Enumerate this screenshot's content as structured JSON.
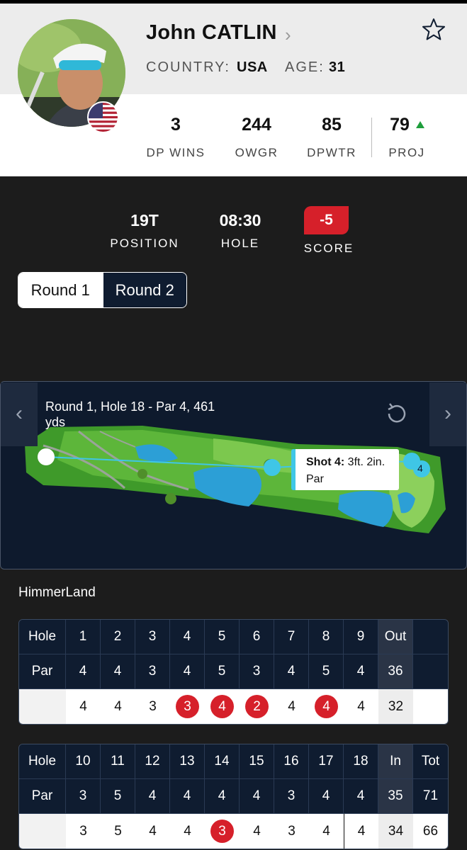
{
  "player": {
    "name": "John CATLIN",
    "country_label": "COUNTRY:",
    "country": "USA",
    "age_label": "AGE:",
    "age": "31",
    "flag_icon": "us-flag-icon",
    "favorite_icon": "star-outline-icon"
  },
  "stats": [
    {
      "value": "3",
      "label": "DP WINS"
    },
    {
      "value": "244",
      "label": "OWGR"
    },
    {
      "value": "85",
      "label": "DPWTR"
    },
    {
      "value": "79",
      "label": "PROJ",
      "trend": "up"
    }
  ],
  "summary": {
    "position": {
      "value": "19T",
      "label": "POSITION"
    },
    "hole": {
      "value": "08:30",
      "label": "HOLE"
    },
    "score": {
      "value": "-5",
      "label": "SCORE"
    }
  },
  "rounds": {
    "tabs": [
      "Round 1",
      "Round 2"
    ],
    "selected": "Round 1"
  },
  "hole_map": {
    "title": "Round 1, Hole 18 - Par 4, 461 yds",
    "shot_label": "Shot 4:",
    "shot_distance": "3ft. 2in.",
    "shot_result": "Par",
    "ball_number": "4"
  },
  "course": {
    "name": "HimmerLand"
  },
  "scorecard": {
    "front": {
      "hole_label": "Hole",
      "par_label": "Par",
      "holes": [
        "1",
        "2",
        "3",
        "4",
        "5",
        "6",
        "7",
        "8",
        "9"
      ],
      "total_label": "Out",
      "pars": [
        "4",
        "4",
        "3",
        "4",
        "5",
        "3",
        "4",
        "5",
        "4"
      ],
      "par_total": "36",
      "scores": [
        "4",
        "4",
        "3",
        "3",
        "4",
        "2",
        "4",
        "4",
        "4"
      ],
      "score_total": "32"
    },
    "back": {
      "hole_label": "Hole",
      "par_label": "Par",
      "holes": [
        "10",
        "11",
        "12",
        "13",
        "14",
        "15",
        "16",
        "17",
        "18"
      ],
      "total_label": "In",
      "grand_label": "Tot",
      "pars": [
        "3",
        "5",
        "4",
        "4",
        "4",
        "4",
        "3",
        "4",
        "4"
      ],
      "par_total": "35",
      "par_grand": "71",
      "scores": [
        "3",
        "5",
        "4",
        "4",
        "3",
        "4",
        "3",
        "4",
        "4"
      ],
      "score_total": "34",
      "score_grand": "66"
    }
  },
  "colors": {
    "accent_red": "#d6202a",
    "navy": "#0f1c30",
    "trend_green": "#1e9e3c",
    "shot_blue": "#3fc6e6"
  }
}
